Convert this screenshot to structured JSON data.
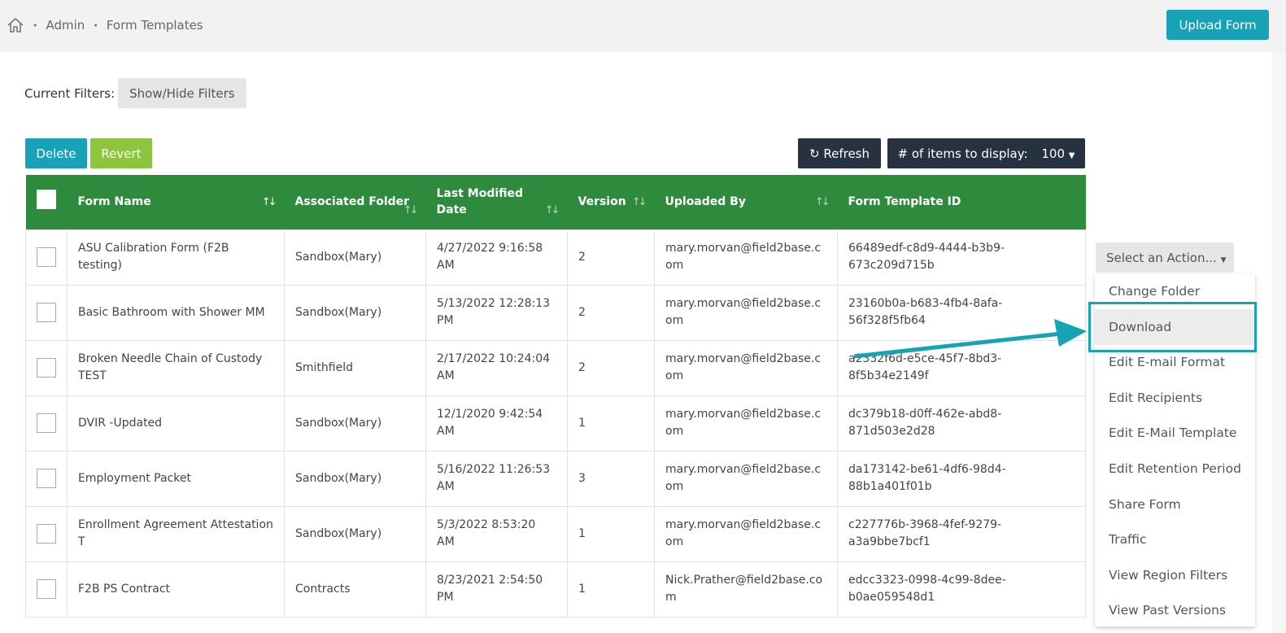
{
  "breadcrumb": {
    "items": [
      "Admin",
      "Form Templates"
    ]
  },
  "header": {
    "upload_label": "Upload Form"
  },
  "filters": {
    "label": "Current Filters:",
    "toggle_label": "Show/Hide Filters"
  },
  "toolbar": {
    "delete_label": "Delete",
    "revert_label": "Revert",
    "refresh_label": "Refresh",
    "items_label": "# of items to display:",
    "items_value": "100"
  },
  "table": {
    "columns": [
      "Form Name",
      "Associated Folder",
      "Last Modified Date",
      "Version",
      "Uploaded By",
      "Form Template ID"
    ],
    "rows": [
      {
        "name": "ASU Calibration Form (F2B testing)",
        "folder": "Sandbox(Mary)",
        "date": "4/27/2022 9:16:58 AM",
        "version": "2",
        "by": "mary.morvan@field2base.c om",
        "id": "66489edf-c8d9-4444-b3b9-673c209d715b"
      },
      {
        "name": "Basic Bathroom with Shower MM",
        "folder": "Sandbox(Mary)",
        "date": "5/13/2022 12:28:13 PM",
        "version": "2",
        "by": "mary.morvan@field2base.c om",
        "id": "23160b0a-b683-4fb4-8afa-56f328f5fb64"
      },
      {
        "name": "Broken Needle Chain of Custody TEST",
        "folder": "Smithfield",
        "date": "2/17/2022 10:24:04 AM",
        "version": "2",
        "by": "mary.morvan@field2base.c om",
        "id": "a2332f6d-e5ce-45f7-8bd3-8f5b34e2149f"
      },
      {
        "name": "DVIR -Updated",
        "folder": "Sandbox(Mary)",
        "date": "12/1/2020 9:42:54 AM",
        "version": "1",
        "by": "mary.morvan@field2base.c om",
        "id": "dc379b18-d0ff-462e-abd8-871d503e2d28"
      },
      {
        "name": "Employment Packet",
        "folder": "Sandbox(Mary)",
        "date": "5/16/2022 11:26:53 AM",
        "version": "3",
        "by": "mary.morvan@field2base.c om",
        "id": "da173142-be61-4df6-98d4-88b1a401f01b"
      },
      {
        "name": "Enrollment Agreement Attestation T",
        "folder": "Sandbox(Mary)",
        "date": "5/3/2022 8:53:20 AM",
        "version": "1",
        "by": "mary.morvan@field2base.c om",
        "id": "c227776b-3968-4fef-9279-a3a9bbe7bcf1"
      },
      {
        "name": "F2B PS Contract",
        "folder": "Contracts",
        "date": "8/23/2021 2:54:50 PM",
        "version": "1",
        "by": "Nick.Prather@field2base.co m",
        "id": "edcc3323-0998-4c99-8dee-b0ae059548d1"
      }
    ]
  },
  "actions": {
    "select_label": "Select an Action...",
    "menu": [
      "Change Folder",
      "Download",
      "Edit E-mail Format",
      "Edit Recipients",
      "Edit E-Mail Template",
      "Edit Retention Period",
      "Share Form",
      "Traffic",
      "View Region Filters",
      "View Past Versions"
    ],
    "highlighted": "Download"
  },
  "colors": {
    "header_green": "#2e8b3e",
    "teal": "#17a2b8",
    "lime": "#8cc63f",
    "dark": "#263240"
  }
}
